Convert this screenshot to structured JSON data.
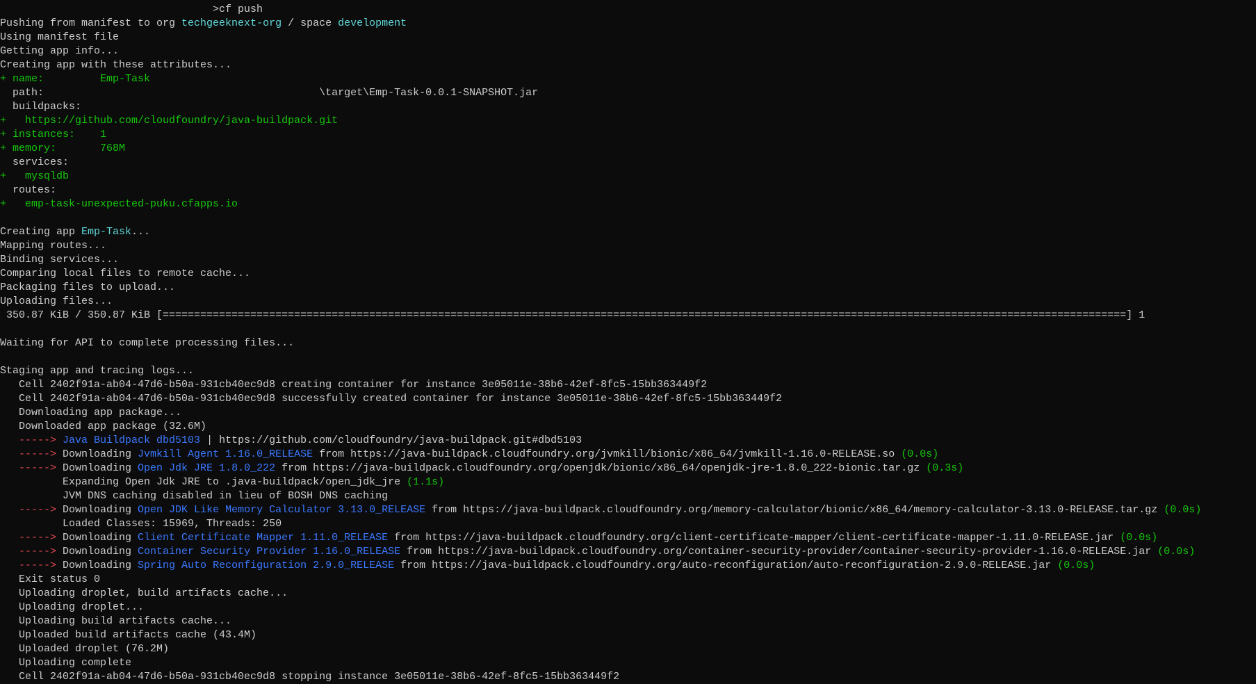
{
  "terminal": {
    "colors": {
      "background": "#0c0c0c",
      "default": "#cccccc",
      "cyan": "#61d6d6",
      "green": "#16c60c",
      "red": "#e74856",
      "blue": "#3b78ff"
    },
    "lines": [
      [
        {
          "t": "                                  >cf push",
          "c": "default"
        }
      ],
      [
        {
          "t": "Pushing from manifest to org ",
          "c": "default"
        },
        {
          "t": "techgeeknext-org",
          "c": "cyan"
        },
        {
          "t": " / space ",
          "c": "default"
        },
        {
          "t": "development",
          "c": "cyan"
        }
      ],
      [
        {
          "t": "Using manifest file",
          "c": "default"
        }
      ],
      [
        {
          "t": "Getting app info...",
          "c": "default"
        }
      ],
      [
        {
          "t": "Creating app with these attributes...",
          "c": "default"
        }
      ],
      [
        {
          "t": "+ name:         Emp-Task",
          "c": "green"
        }
      ],
      [
        {
          "t": "  path:                                            \\target\\Emp-Task-0.0.1-SNAPSHOT.jar",
          "c": "default"
        }
      ],
      [
        {
          "t": "  buildpacks:",
          "c": "default"
        }
      ],
      [
        {
          "t": "+   https://github.com/cloudfoundry/java-buildpack.git",
          "c": "green"
        }
      ],
      [
        {
          "t": "+ instances:    1",
          "c": "green"
        }
      ],
      [
        {
          "t": "+ memory:       768M",
          "c": "green"
        }
      ],
      [
        {
          "t": "  services:",
          "c": "default"
        }
      ],
      [
        {
          "t": "+   mysqldb",
          "c": "green"
        }
      ],
      [
        {
          "t": "  routes:",
          "c": "default"
        }
      ],
      [
        {
          "t": "+   emp-task-unexpected-puku.cfapps.io",
          "c": "green"
        }
      ],
      [
        {
          "t": "",
          "c": "default"
        }
      ],
      [
        {
          "t": "Creating app ",
          "c": "default"
        },
        {
          "t": "Emp-Task",
          "c": "cyan"
        },
        {
          "t": "...",
          "c": "default"
        }
      ],
      [
        {
          "t": "Mapping routes...",
          "c": "default"
        }
      ],
      [
        {
          "t": "Binding services...",
          "c": "default"
        }
      ],
      [
        {
          "t": "Comparing local files to remote cache...",
          "c": "default"
        }
      ],
      [
        {
          "t": "Packaging files to upload...",
          "c": "default"
        }
      ],
      [
        {
          "t": "Uploading files...",
          "c": "default"
        }
      ],
      [
        {
          "t": " 350.87 KiB / 350.87 KiB [==========================================================================================================================================================] 1",
          "c": "default"
        }
      ],
      [
        {
          "t": "",
          "c": "default"
        }
      ],
      [
        {
          "t": "Waiting for API to complete processing files...",
          "c": "default"
        }
      ],
      [
        {
          "t": "",
          "c": "default"
        }
      ],
      [
        {
          "t": "Staging app and tracing logs...",
          "c": "default"
        }
      ],
      [
        {
          "t": "   Cell 2402f91a-ab04-47d6-b50a-931cb40ec9d8 creating container for instance 3e05011e-38b6-42ef-8fc5-15bb363449f2",
          "c": "default"
        }
      ],
      [
        {
          "t": "   Cell 2402f91a-ab04-47d6-b50a-931cb40ec9d8 successfully created container for instance 3e05011e-38b6-42ef-8fc5-15bb363449f2",
          "c": "default"
        }
      ],
      [
        {
          "t": "   Downloading app package...",
          "c": "default"
        }
      ],
      [
        {
          "t": "   Downloaded app package (32.6M)",
          "c": "default"
        }
      ],
      [
        {
          "t": "   -----> ",
          "c": "red"
        },
        {
          "t": "Java Buildpack dbd5103",
          "c": "blue"
        },
        {
          "t": " | https://github.com/cloudfoundry/java-buildpack.git#dbd5103",
          "c": "default"
        }
      ],
      [
        {
          "t": "   -----> ",
          "c": "red"
        },
        {
          "t": "Downloading ",
          "c": "default"
        },
        {
          "t": "Jvmkill Agent 1.16.0_RELEASE",
          "c": "blue"
        },
        {
          "t": " from https://java-buildpack.cloudfoundry.org/jvmkill/bionic/x86_64/jvmkill-1.16.0-RELEASE.so ",
          "c": "default"
        },
        {
          "t": "(0.0s)",
          "c": "green"
        }
      ],
      [
        {
          "t": "   -----> ",
          "c": "red"
        },
        {
          "t": "Downloading ",
          "c": "default"
        },
        {
          "t": "Open Jdk JRE 1.8.0_222",
          "c": "blue"
        },
        {
          "t": " from https://java-buildpack.cloudfoundry.org/openjdk/bionic/x86_64/openjdk-jre-1.8.0_222-bionic.tar.gz ",
          "c": "default"
        },
        {
          "t": "(0.3s)",
          "c": "green"
        }
      ],
      [
        {
          "t": "          Expanding Open Jdk JRE to .java-buildpack/open_jdk_jre ",
          "c": "default"
        },
        {
          "t": "(1.1s)",
          "c": "green"
        }
      ],
      [
        {
          "t": "          JVM DNS caching disabled in lieu of BOSH DNS caching",
          "c": "default"
        }
      ],
      [
        {
          "t": "   -----> ",
          "c": "red"
        },
        {
          "t": "Downloading ",
          "c": "default"
        },
        {
          "t": "Open JDK Like Memory Calculator 3.13.0_RELEASE",
          "c": "blue"
        },
        {
          "t": " from https://java-buildpack.cloudfoundry.org/memory-calculator/bionic/x86_64/memory-calculator-3.13.0-RELEASE.tar.gz ",
          "c": "default"
        },
        {
          "t": "(0.0s)",
          "c": "green"
        }
      ],
      [
        {
          "t": "          Loaded Classes: 15969, Threads: 250",
          "c": "default"
        }
      ],
      [
        {
          "t": "   -----> ",
          "c": "red"
        },
        {
          "t": "Downloading ",
          "c": "default"
        },
        {
          "t": "Client Certificate Mapper 1.11.0_RELEASE",
          "c": "blue"
        },
        {
          "t": " from https://java-buildpack.cloudfoundry.org/client-certificate-mapper/client-certificate-mapper-1.11.0-RELEASE.jar ",
          "c": "default"
        },
        {
          "t": "(0.0s)",
          "c": "green"
        }
      ],
      [
        {
          "t": "   -----> ",
          "c": "red"
        },
        {
          "t": "Downloading ",
          "c": "default"
        },
        {
          "t": "Container Security Provider 1.16.0_RELEASE",
          "c": "blue"
        },
        {
          "t": " from https://java-buildpack.cloudfoundry.org/container-security-provider/container-security-provider-1.16.0-RELEASE.jar ",
          "c": "default"
        },
        {
          "t": "(0.0s)",
          "c": "green"
        }
      ],
      [
        {
          "t": "   -----> ",
          "c": "red"
        },
        {
          "t": "Downloading ",
          "c": "default"
        },
        {
          "t": "Spring Auto Reconfiguration 2.9.0_RELEASE",
          "c": "blue"
        },
        {
          "t": " from https://java-buildpack.cloudfoundry.org/auto-reconfiguration/auto-reconfiguration-2.9.0-RELEASE.jar ",
          "c": "default"
        },
        {
          "t": "(0.0s)",
          "c": "green"
        }
      ],
      [
        {
          "t": "   Exit status 0",
          "c": "default"
        }
      ],
      [
        {
          "t": "   Uploading droplet, build artifacts cache...",
          "c": "default"
        }
      ],
      [
        {
          "t": "   Uploading droplet...",
          "c": "default"
        }
      ],
      [
        {
          "t": "   Uploading build artifacts cache...",
          "c": "default"
        }
      ],
      [
        {
          "t": "   Uploaded build artifacts cache (43.4M)",
          "c": "default"
        }
      ],
      [
        {
          "t": "   Uploaded droplet (76.2M)",
          "c": "default"
        }
      ],
      [
        {
          "t": "   Uploading complete",
          "c": "default"
        }
      ],
      [
        {
          "t": "   Cell 2402f91a-ab04-47d6-b50a-931cb40ec9d8 stopping instance 3e05011e-38b6-42ef-8fc5-15bb363449f2",
          "c": "default"
        }
      ]
    ]
  }
}
